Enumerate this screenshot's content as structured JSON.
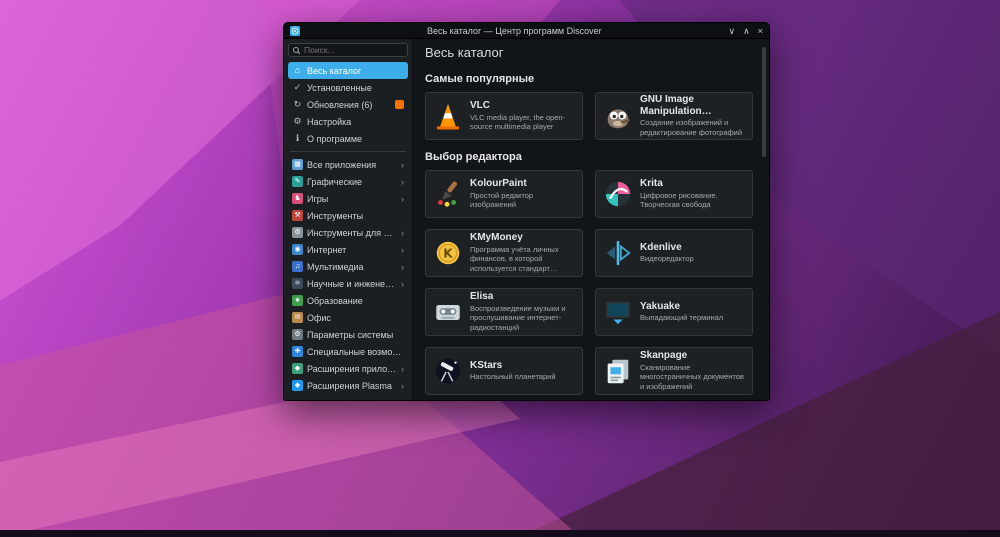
{
  "window": {
    "title": "Весь каталог — Центр программ Discover",
    "controls": {
      "minimize": "∨",
      "maximize": "∧",
      "close": "×"
    }
  },
  "sidebar": {
    "search": {
      "placeholder": "Поиск...",
      "icon": "search-icon"
    },
    "top_items": [
      {
        "label": "Весь каталог",
        "icon": "home-icon",
        "glyph": "⌂",
        "selected": true
      },
      {
        "label": "Установленные",
        "icon": "installed-icon",
        "glyph": "✓",
        "selected": false
      },
      {
        "label": "Обновления (6)",
        "icon": "updates-icon",
        "glyph": "↻",
        "selected": false,
        "badge": true
      },
      {
        "label": "Настройка",
        "icon": "settings-icon",
        "glyph": "⚙",
        "selected": false
      },
      {
        "label": "О программе",
        "icon": "about-icon",
        "glyph": "ℹ",
        "selected": false
      }
    ],
    "categories": [
      {
        "label": "Все приложения",
        "icon": "all-apps-icon",
        "glyph": "▦",
        "color": "#5d9fd4",
        "chevron": true
      },
      {
        "label": "Графические",
        "icon": "graphics-icon",
        "glyph": "✎",
        "color": "#2aa198",
        "chevron": true
      },
      {
        "label": "Игры",
        "icon": "games-icon",
        "glyph": "♞",
        "color": "#d94f7a",
        "chevron": true
      },
      {
        "label": "Инструменты",
        "icon": "utilities-icon",
        "glyph": "⚒",
        "color": "#c0443a",
        "chevron": false
      },
      {
        "label": "Инструменты для разработки",
        "icon": "development-icon",
        "glyph": "⚙",
        "color": "#8a9299",
        "chevron": true
      },
      {
        "label": "Интернет",
        "icon": "internet-icon",
        "glyph": "◉",
        "color": "#3a86c8",
        "chevron": true
      },
      {
        "label": "Мультимедиа",
        "icon": "multimedia-icon",
        "glyph": "♫",
        "color": "#3a6ec8",
        "chevron": true
      },
      {
        "label": "Научные и инженерные",
        "icon": "science-icon",
        "glyph": "⚛",
        "color": "#3b4b5a",
        "chevron": true
      },
      {
        "label": "Образование",
        "icon": "education-icon",
        "glyph": "★",
        "color": "#3f9e4d",
        "chevron": false
      },
      {
        "label": "Офис",
        "icon": "office-icon",
        "glyph": "✉",
        "color": "#b98a4e",
        "chevron": false
      },
      {
        "label": "Параметры системы",
        "icon": "system-settings-icon",
        "glyph": "⚙",
        "color": "#6f7a82",
        "chevron": false
      },
      {
        "label": "Специальные возможности",
        "icon": "accessibility-icon",
        "glyph": "✚",
        "color": "#2e86de",
        "chevron": false
      },
      {
        "label": "Расширения приложений",
        "icon": "app-addons-icon",
        "glyph": "◆",
        "color": "#3f9e7a",
        "chevron": true
      },
      {
        "label": "Расширения Plasma",
        "icon": "plasma-addons-icon",
        "glyph": "◆",
        "color": "#1d99f3",
        "chevron": true
      }
    ]
  },
  "main": {
    "title": "Весь каталог",
    "sections": [
      {
        "title": "Самые популярные",
        "apps": [
          {
            "name": "VLC",
            "description": "VLC media player, the open-source multimedia player",
            "icon": "vlc-icon"
          },
          {
            "name": "GNU Image Manipulation Program",
            "description": "Создание изображений и редактирование фотографий",
            "icon": "gimp-icon"
          }
        ]
      },
      {
        "title": "Выбор редактора",
        "apps": [
          {
            "name": "KolourPaint",
            "description": "Простой редактор изображений",
            "icon": "kolourpaint-icon"
          },
          {
            "name": "Krita",
            "description": "Цифровое рисование. Творческая свобода",
            "icon": "krita-icon"
          },
          {
            "name": "KMyMoney",
            "description": "Программа учёта личных финансов, в которой используется стандарт двойной",
            "icon": "kmymoney-icon"
          },
          {
            "name": "Kdenlive",
            "description": "Видеоредактор",
            "icon": "kdenlive-icon"
          },
          {
            "name": "Elisa",
            "description": "Воспроизведение музыки и прослушивание интернет-радиостанций",
            "icon": "elisa-icon"
          },
          {
            "name": "Yakuake",
            "description": "Выпадающий терминал",
            "icon": "yakuake-icon"
          },
          {
            "name": "KStars",
            "description": "Настольный планетарий",
            "icon": "kstars-icon"
          },
          {
            "name": "Skanpage",
            "description": "Сканирование многостраничных документов и изображений",
            "icon": "skanpage-icon"
          }
        ]
      }
    ]
  },
  "colors": {
    "accent": "#3daee9",
    "updates_badge": "#f67400"
  },
  "ui": {
    "chevron": "›"
  }
}
